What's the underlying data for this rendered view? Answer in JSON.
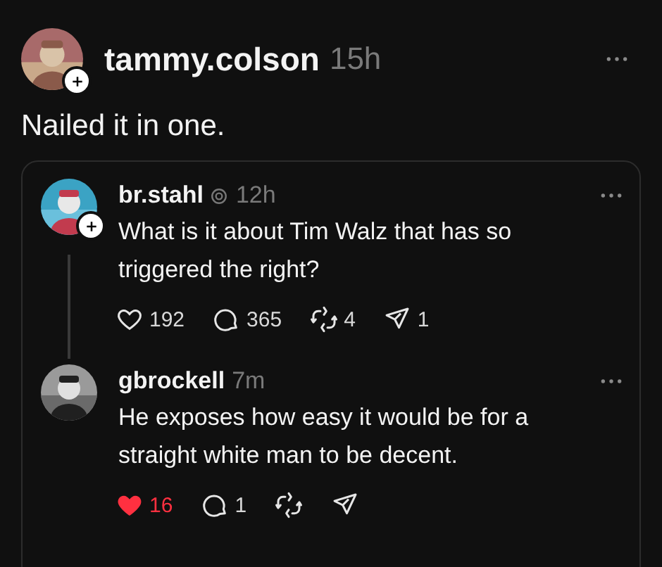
{
  "post": {
    "username": "tammy.colson",
    "time": "15h",
    "follow_badge": true,
    "text": "Nailed it in one."
  },
  "quoted": [
    {
      "username": "br.stahl",
      "verified": true,
      "time": "12h",
      "follow_badge": true,
      "thread_line": true,
      "text": "What is it about Tim Walz that has so triggered the right?",
      "liked": false,
      "actions": [
        {
          "kind": "like",
          "count": "192"
        },
        {
          "kind": "reply",
          "count": "365"
        },
        {
          "kind": "repost",
          "count": "4"
        },
        {
          "kind": "share",
          "count": "1"
        }
      ]
    },
    {
      "username": "gbrockell",
      "verified": false,
      "time": "7m",
      "follow_badge": false,
      "thread_line": false,
      "text": "He exposes how easy it would be for a straight white man to be decent.",
      "liked": true,
      "actions": [
        {
          "kind": "like",
          "count": "16"
        },
        {
          "kind": "reply",
          "count": "1"
        },
        {
          "kind": "repost"
        },
        {
          "kind": "share"
        }
      ]
    }
  ]
}
